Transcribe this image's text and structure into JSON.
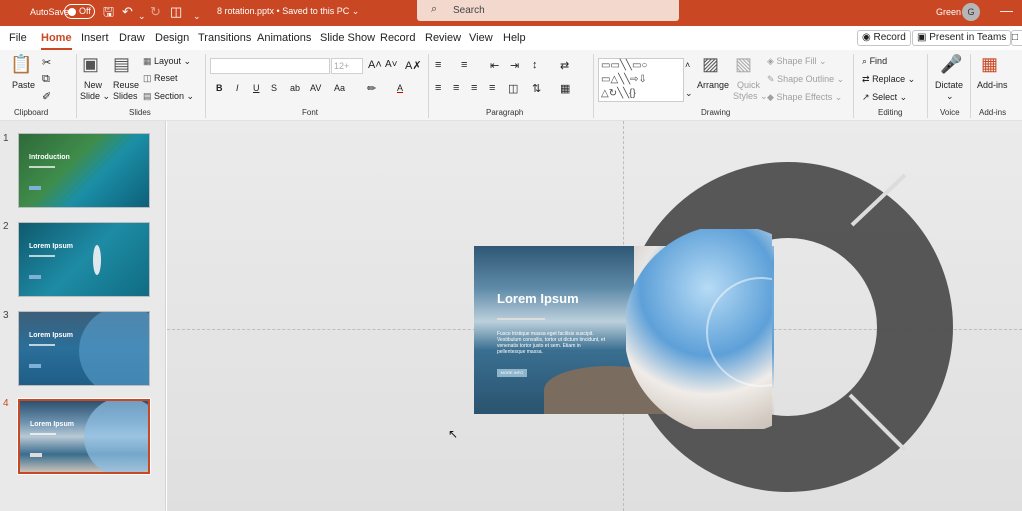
{
  "titlebar": {
    "autosave_label": "AutoSave",
    "autosave_state": "Off",
    "filename": "8 rotation.pptx • Saved to this PC ⌄",
    "search_placeholder": "Search",
    "user_name": "Green",
    "user_initial": "G"
  },
  "tabs": [
    "File",
    "Home",
    "Insert",
    "Draw",
    "Design",
    "Transitions",
    "Animations",
    "Slide Show",
    "Record",
    "Review",
    "View",
    "Help"
  ],
  "tab_buttons": {
    "record": "Record",
    "present_teams": "Present in Teams"
  },
  "ribbon": {
    "clipboard": {
      "paste": "Paste",
      "group": "Clipboard"
    },
    "slides": {
      "new_slide": "New",
      "new_slide2": "Slide ⌄",
      "reuse": "Reuse",
      "reuse2": "Slides",
      "layout": "Layout ⌄",
      "reset": "Reset",
      "section": "Section ⌄",
      "group": "Slides"
    },
    "font": {
      "size": "12+",
      "group": "Font"
    },
    "paragraph": {
      "group": "Paragraph"
    },
    "drawing": {
      "arrange": "Arrange",
      "quick_styles": "Quick",
      "quick_styles2": "Styles ⌄",
      "shape_fill": "Shape Fill ⌄",
      "shape_outline": "Shape Outline ⌄",
      "shape_effects": "Shape Effects ⌄",
      "group": "Drawing"
    },
    "editing": {
      "find": "Find",
      "replace": "Replace ⌄",
      "select": "Select ⌄",
      "group": "Editing"
    },
    "voice": {
      "dictate": "Dictate",
      "dictate2": "⌄",
      "group": "Voice"
    },
    "addins": {
      "addins": "Add-ins",
      "group": "Add-ins"
    }
  },
  "slides_panel": [
    {
      "num": "1",
      "title": "Introduction"
    },
    {
      "num": "2",
      "title": "Lorem Ipsum"
    },
    {
      "num": "3",
      "title": "Lorem Ipsum"
    },
    {
      "num": "4",
      "title": "Lorem Ipsum"
    }
  ],
  "slide": {
    "title": "Lorem Ipsum",
    "body": "Fusce tristique massa eget facilisis suscipit. Vestibulum convallis, tortor ut dictum tincidunt, et venenatis tortor justo et sem. Etiam in pellentesque massa.",
    "button": "MORE INFO"
  },
  "colors": {
    "accent": "#c94722",
    "ring": "#4a4a4a"
  }
}
